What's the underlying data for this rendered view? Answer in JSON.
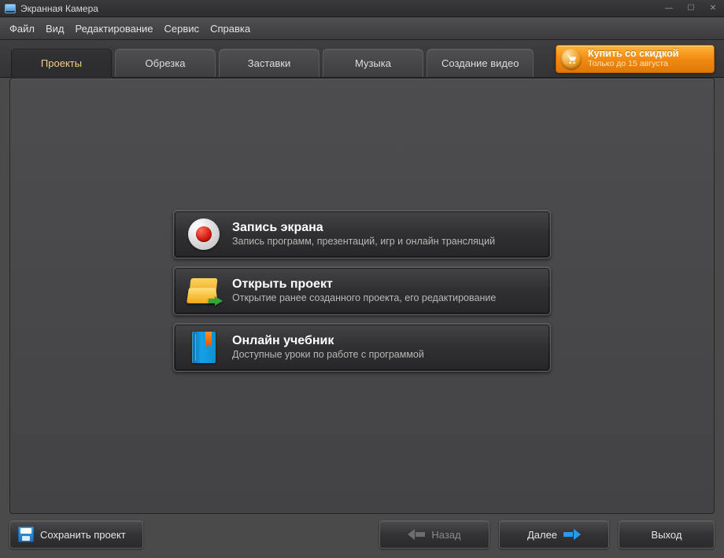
{
  "title": "Экранная Камера",
  "menubar": [
    "Файл",
    "Вид",
    "Редактирование",
    "Сервис",
    "Справка"
  ],
  "tabs": [
    {
      "label": "Проекты",
      "active": true
    },
    {
      "label": "Обрезка",
      "active": false
    },
    {
      "label": "Заставки",
      "active": false
    },
    {
      "label": "Музыка",
      "active": false
    },
    {
      "label": "Создание видео",
      "active": false
    }
  ],
  "promo": {
    "line1": "Купить со скидкой",
    "line2": "Только до 15 августа"
  },
  "cards": {
    "record": {
      "title": "Запись экрана",
      "sub": "Запись программ, презентаций, игр и онлайн трансляций"
    },
    "open": {
      "title": "Открыть проект",
      "sub": "Открытие ранее созданного проекта, его редактирование"
    },
    "tutorial": {
      "title": "Онлайн учебник",
      "sub": "Доступные уроки по работе с программой"
    }
  },
  "footer": {
    "save": "Сохранить проект",
    "back": "Назад",
    "next": "Далее",
    "exit": "Выход"
  }
}
